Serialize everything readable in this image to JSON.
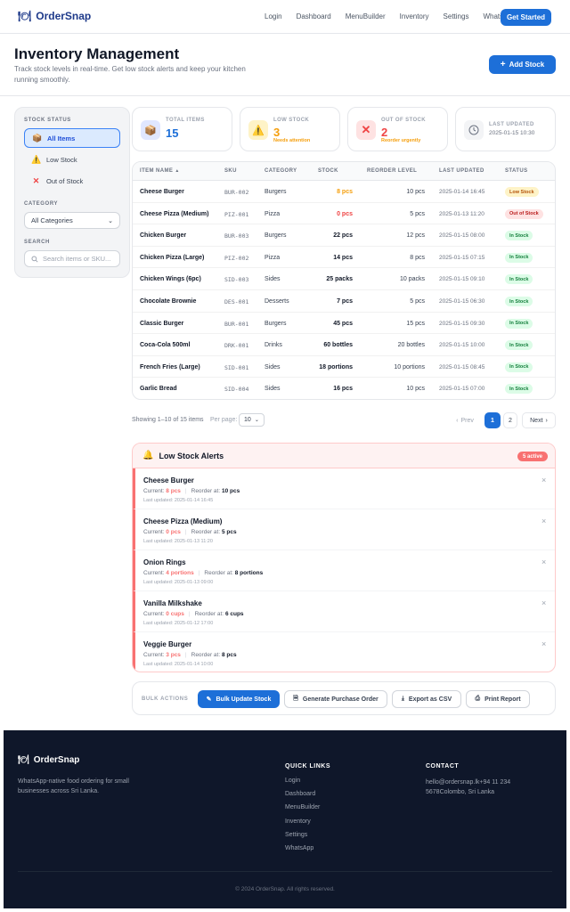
{
  "nav": {
    "brand": "OrderSnap",
    "links": [
      "Login",
      "Dashboard",
      "MenuBuilder",
      "Inventory",
      "Settings",
      "WhatsApp"
    ],
    "cta": "Get Started"
  },
  "header": {
    "title": "Inventory Management",
    "subtitle": "Track stock levels in real-time. Get low stock alerts and keep your kitchen running smoothly.",
    "add_button": "Add Stock"
  },
  "sidebar": {
    "status_heading": "STOCK STATUS",
    "status_items": [
      {
        "label": "All Items",
        "icon": "box-icon",
        "active": true
      },
      {
        "label": "Low Stock",
        "icon": "warning-icon",
        "active": false
      },
      {
        "label": "Out of Stock",
        "icon": "cross-icon",
        "active": false
      }
    ],
    "category_heading": "CATEGORY",
    "category_value": "All Categories",
    "search_heading": "SEARCH",
    "search_placeholder": "Search items or SKU..."
  },
  "stats": {
    "total": {
      "label": "TOTAL ITEMS",
      "value": "15"
    },
    "low": {
      "label": "LOW STOCK",
      "value": "3",
      "note": "Needs attention"
    },
    "out": {
      "label": "OUT OF STOCK",
      "value": "2",
      "note": "Reorder urgently"
    },
    "updated": {
      "label": "LAST UPDATED",
      "value": "2025-01-15 10:30"
    }
  },
  "table": {
    "headers": [
      "ITEM NAME",
      "SKU",
      "CATEGORY",
      "STOCK",
      "REORDER LEVEL",
      "LAST UPDATED",
      "STATUS"
    ],
    "sort_indicator": "▲",
    "rows": [
      {
        "name": "Cheese Burger",
        "sku": "BUR-002",
        "category": "Burgers",
        "stock": "8 pcs",
        "reorder": "10 pcs",
        "updated": "2025-01-14 16:45",
        "status": "Low Stock",
        "level": "low"
      },
      {
        "name": "Cheese Pizza (Medium)",
        "sku": "PIZ-001",
        "category": "Pizza",
        "stock": "0 pcs",
        "reorder": "5 pcs",
        "updated": "2025-01-13 11:20",
        "status": "Out of Stock",
        "level": "out"
      },
      {
        "name": "Chicken Burger",
        "sku": "BUR-003",
        "category": "Burgers",
        "stock": "22 pcs",
        "reorder": "12 pcs",
        "updated": "2025-01-15 08:00",
        "status": "In Stock",
        "level": "in"
      },
      {
        "name": "Chicken Pizza (Large)",
        "sku": "PIZ-002",
        "category": "Pizza",
        "stock": "14 pcs",
        "reorder": "8 pcs",
        "updated": "2025-01-15 07:15",
        "status": "In Stock",
        "level": "in"
      },
      {
        "name": "Chicken Wings (6pc)",
        "sku": "SID-003",
        "category": "Sides",
        "stock": "25 packs",
        "reorder": "10 packs",
        "updated": "2025-01-15 09:10",
        "status": "In Stock",
        "level": "in"
      },
      {
        "name": "Chocolate Brownie",
        "sku": "DES-001",
        "category": "Desserts",
        "stock": "7 pcs",
        "reorder": "5 pcs",
        "updated": "2025-01-15 06:30",
        "status": "In Stock",
        "level": "in"
      },
      {
        "name": "Classic Burger",
        "sku": "BUR-001",
        "category": "Burgers",
        "stock": "45 pcs",
        "reorder": "15 pcs",
        "updated": "2025-01-15 09:30",
        "status": "In Stock",
        "level": "in"
      },
      {
        "name": "Coca-Cola 500ml",
        "sku": "DRK-001",
        "category": "Drinks",
        "stock": "60 bottles",
        "reorder": "20 bottles",
        "updated": "2025-01-15 10:00",
        "status": "In Stock",
        "level": "in"
      },
      {
        "name": "French Fries (Large)",
        "sku": "SID-001",
        "category": "Sides",
        "stock": "18 portions",
        "reorder": "10 portions",
        "updated": "2025-01-15 08:45",
        "status": "In Stock",
        "level": "in"
      },
      {
        "name": "Garlic Bread",
        "sku": "SID-004",
        "category": "Sides",
        "stock": "16 pcs",
        "reorder": "10 pcs",
        "updated": "2025-01-15 07:00",
        "status": "In Stock",
        "level": "in"
      }
    ]
  },
  "pagination": {
    "info": "Showing 1–10 of 15 items",
    "per_page_label": "Per page:",
    "per_page": "10",
    "prev": "Prev",
    "pages": [
      "1",
      "2"
    ],
    "next": "Next"
  },
  "alerts": {
    "title": "Low Stock Alerts",
    "badge": "5 active",
    "current_label": "Current:",
    "reorder_label": "Reorder at:",
    "updated_label": "Last updated:",
    "items": [
      {
        "name": "Cheese Burger",
        "current": "8 pcs",
        "reorder": "10 pcs",
        "updated": "2025-01-14 16:45"
      },
      {
        "name": "Cheese Pizza (Medium)",
        "current": "0 pcs",
        "reorder": "5 pcs",
        "updated": "2025-01-13 11:20"
      },
      {
        "name": "Onion Rings",
        "current": "4 portions",
        "reorder": "8 portions",
        "updated": "2025-01-13 09:00"
      },
      {
        "name": "Vanilla Milkshake",
        "current": "0 cups",
        "reorder": "6 cups",
        "updated": "2025-01-12 17:00"
      },
      {
        "name": "Veggie Burger",
        "current": "3 pcs",
        "reorder": "8 pcs",
        "updated": "2025-01-14 10:00"
      }
    ]
  },
  "bulk": {
    "label": "BULK ACTIONS",
    "buttons": [
      "Bulk Update Stock",
      "Generate Purchase Order",
      "Export as CSV",
      "Print Report"
    ]
  },
  "footer": {
    "brand": "OrderSnap",
    "description": "WhatsApp-native food ordering for small businesses across Sri Lanka.",
    "links_heading": "QUICK LINKS",
    "links": [
      "Login",
      "Dashboard",
      "MenuBuilder",
      "Inventory",
      "Settings",
      "WhatsApp"
    ],
    "contact_heading": "CONTACT",
    "contact_line1": "hello@ordersnap.lk+94 11 234",
    "contact_line2": "5678Colombo, Sri Lanka",
    "copyright": "© 2024 OrderSnap. All rights reserved."
  },
  "colors": {
    "primary": "#1d6fd8",
    "low": "#f59e0b",
    "out": "#ef4444",
    "in": "#16a34a",
    "footer_bg": "#0f172a"
  }
}
